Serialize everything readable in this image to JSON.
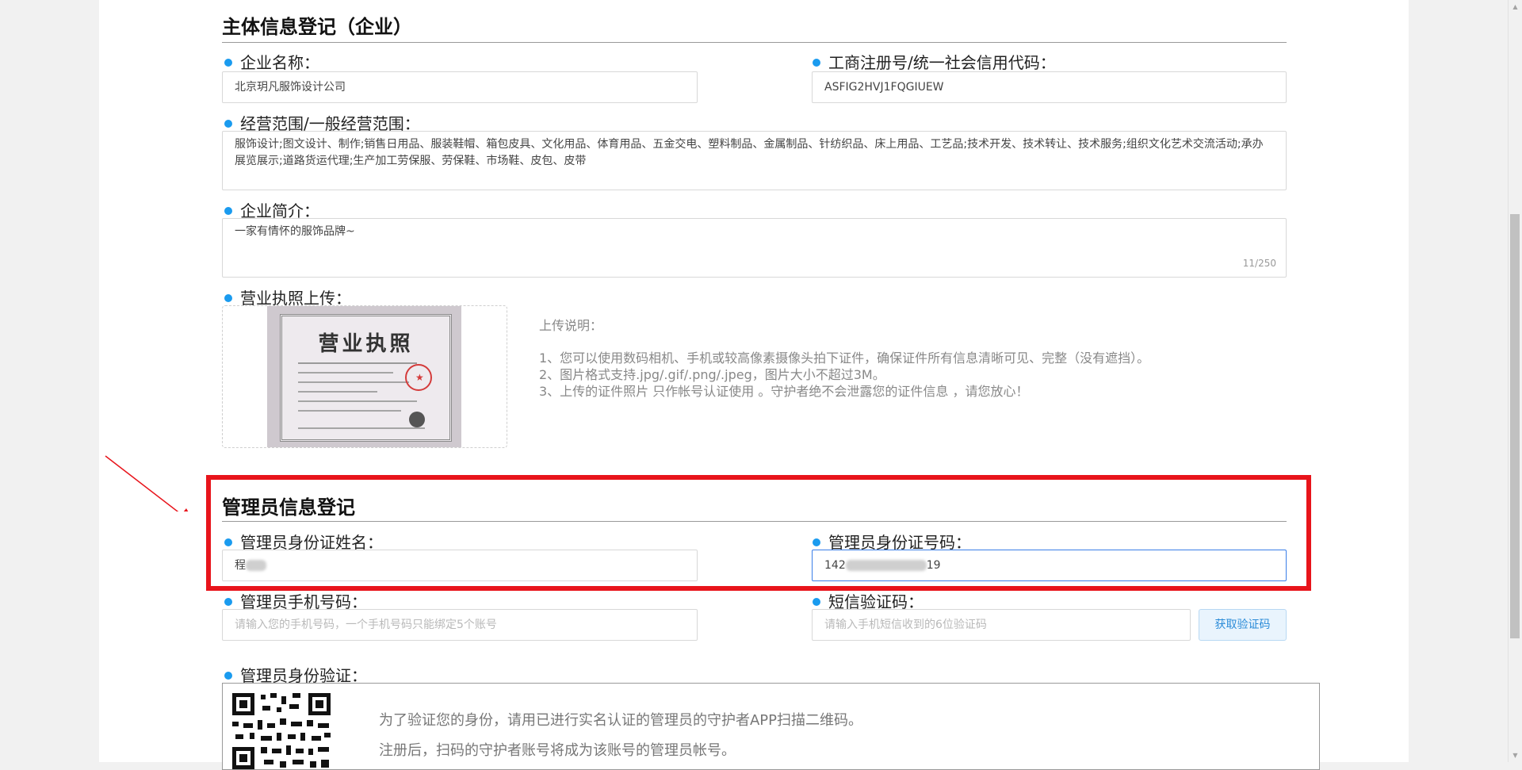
{
  "company_section": {
    "title": "主体信息登记（企业）",
    "company_name": {
      "label": "企业名称：",
      "value": "北京玥凡服饰设计公司"
    },
    "reg_code": {
      "label": "工商注册号/统一社会信用代码：",
      "value": "ASFIG2HVJ1FQGIUEW"
    },
    "business_scope": {
      "label": "经营范围/一般经营范围：",
      "value": "服饰设计;图文设计、制作;销售日用品、服装鞋帽、箱包皮具、文化用品、体育用品、五金交电、塑料制品、金属制品、针纺织品、床上用品、工艺品;技术开发、技术转让、技术服务;组织文化艺术交流活动;承办展览展示;道路货运代理;生产加工劳保服、劳保鞋、市场鞋、皮包、皮带"
    },
    "intro": {
      "label": "企业简介：",
      "value": "一家有情怀的服饰品牌~",
      "counter": "11/250"
    },
    "license_upload": {
      "label": "营业执照上传：",
      "license_title": "营业执照",
      "note_title": "上传说明：",
      "notes": [
        "1、您可以使用数码相机、手机或较高像素摄像头拍下证件，确保证件所有信息清晰可见、完整（没有遮挡）。",
        "2、图片格式支持.jpg/.gif/.png/.jpeg，图片大小不超过3M。",
        "3、上传的证件照片 只作帐号认证使用 。守护者绝不会泄露您的证件信息 ，请您放心！"
      ]
    }
  },
  "admin_section": {
    "title": "管理员信息登记",
    "name": {
      "label": "管理员身份证姓名：",
      "value": "程"
    },
    "id_number": {
      "label": "管理员身份证号码：",
      "prefix": "142",
      "suffix": "19"
    },
    "phone": {
      "label": "管理员手机号码：",
      "placeholder": "请输入您的手机号码，一个手机号码只能绑定5个账号"
    },
    "sms": {
      "label": "短信验证码：",
      "placeholder": "请输入手机短信收到的6位验证码",
      "button": "获取验证码"
    },
    "verify": {
      "label": "管理员身份验证：",
      "line1": "为了验证您的身份，请用已进行实名认证的管理员的守护者APP扫描二维码。",
      "line2": "注册后，扫码的守护者账号将成为该账号的管理员帐号。"
    }
  },
  "colors": {
    "accent_dot": "#1a9bef",
    "highlight": "#e8141b",
    "arrow": "#e8141b"
  }
}
